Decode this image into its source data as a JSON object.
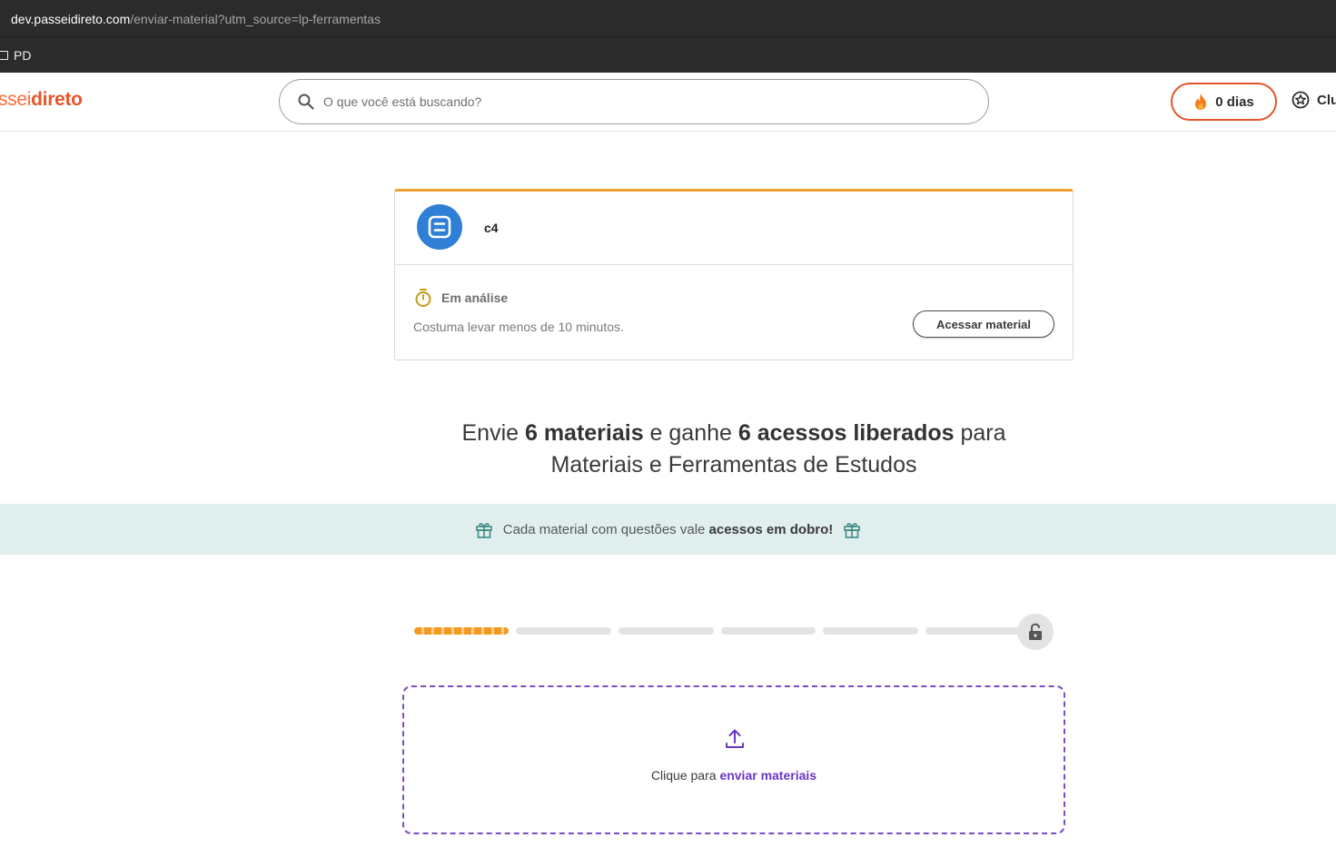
{
  "browser": {
    "url_host": "dev.passeidireto.com",
    "url_path": "/enviar-material?utm_source=lp-ferramentas",
    "bookmark_label": "PD"
  },
  "header": {
    "logo_part1": "ssei",
    "logo_part2": "direto",
    "search_placeholder": "O que você está buscando?",
    "streak_label": "0 dias",
    "club_label": "Clu"
  },
  "material_card": {
    "title": "c4",
    "status_label": "Em análise",
    "status_note": "Costuma levar menos de 10 minutos.",
    "access_button": "Acessar material"
  },
  "headline": {
    "part1": "Envie ",
    "bold1": "6 materiais",
    "part2": " e ganhe ",
    "bold2": "6 acessos liberados",
    "part3": " para",
    "line2": "Materiais e Ferramentas de Estudos"
  },
  "banner": {
    "text": "Cada material com questões vale ",
    "bold": "acessos em dobro!"
  },
  "progress": {
    "total_steps": 6,
    "completed_steps": 1
  },
  "upload": {
    "text": "Clique para ",
    "link": "enviar materiais"
  },
  "colors": {
    "brand_orange": "#e5552a",
    "card_accent": "#f0a030",
    "upload_purple": "#6a36c4",
    "banner_bg": "#e0efee"
  }
}
